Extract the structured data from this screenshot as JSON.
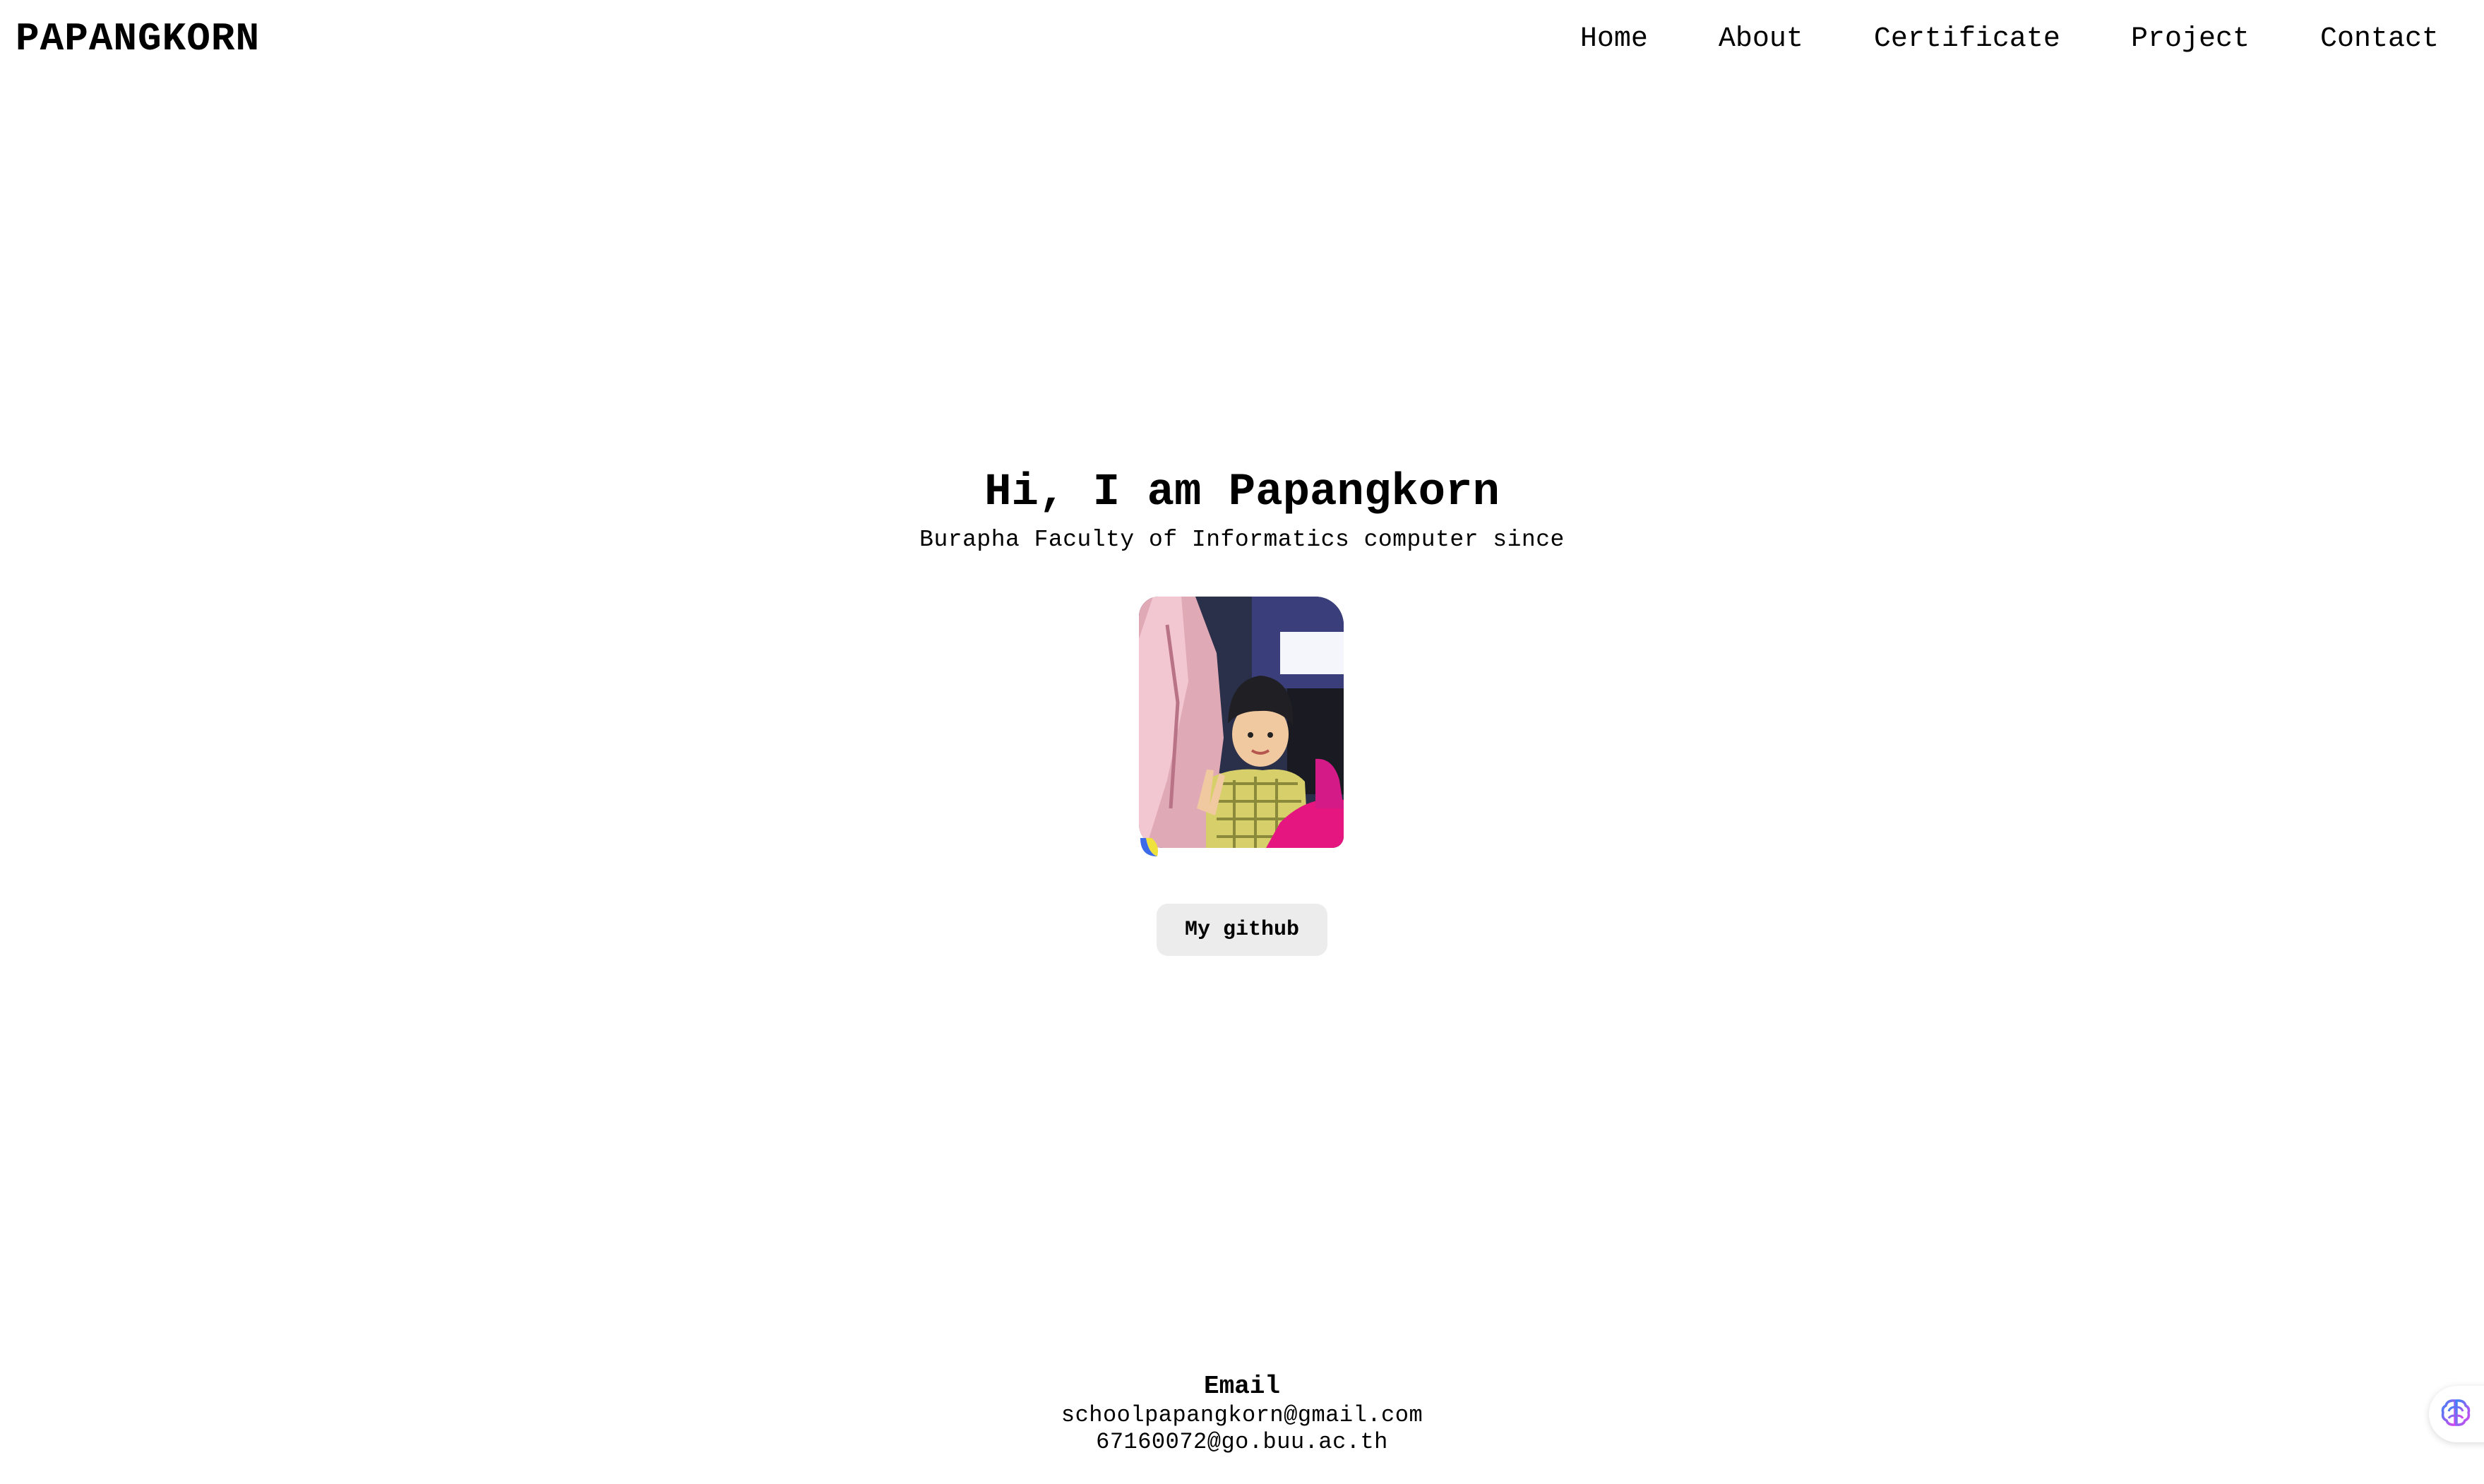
{
  "header": {
    "brand": "PAPANGKORN",
    "nav": [
      {
        "label": "Home"
      },
      {
        "label": "About"
      },
      {
        "label": "Certificate"
      },
      {
        "label": "Project"
      },
      {
        "label": "Contact"
      }
    ]
  },
  "hero": {
    "title": "Hi, I am Papangkorn",
    "subtitle": "Burapha Faculty of Informatics computer since",
    "button_label": "My github"
  },
  "footer": {
    "title": "Email",
    "emails": [
      "schoolpapangkorn@gmail.com",
      "67160072@go.buu.ac.th"
    ]
  },
  "icons": {
    "floating_button": "brain-icon"
  },
  "colors": {
    "background": "#ffffff",
    "text": "#000000",
    "button_bg": "#ececec",
    "brain_gradient_start": "#3b82f6",
    "brain_gradient_end": "#d946ef"
  }
}
